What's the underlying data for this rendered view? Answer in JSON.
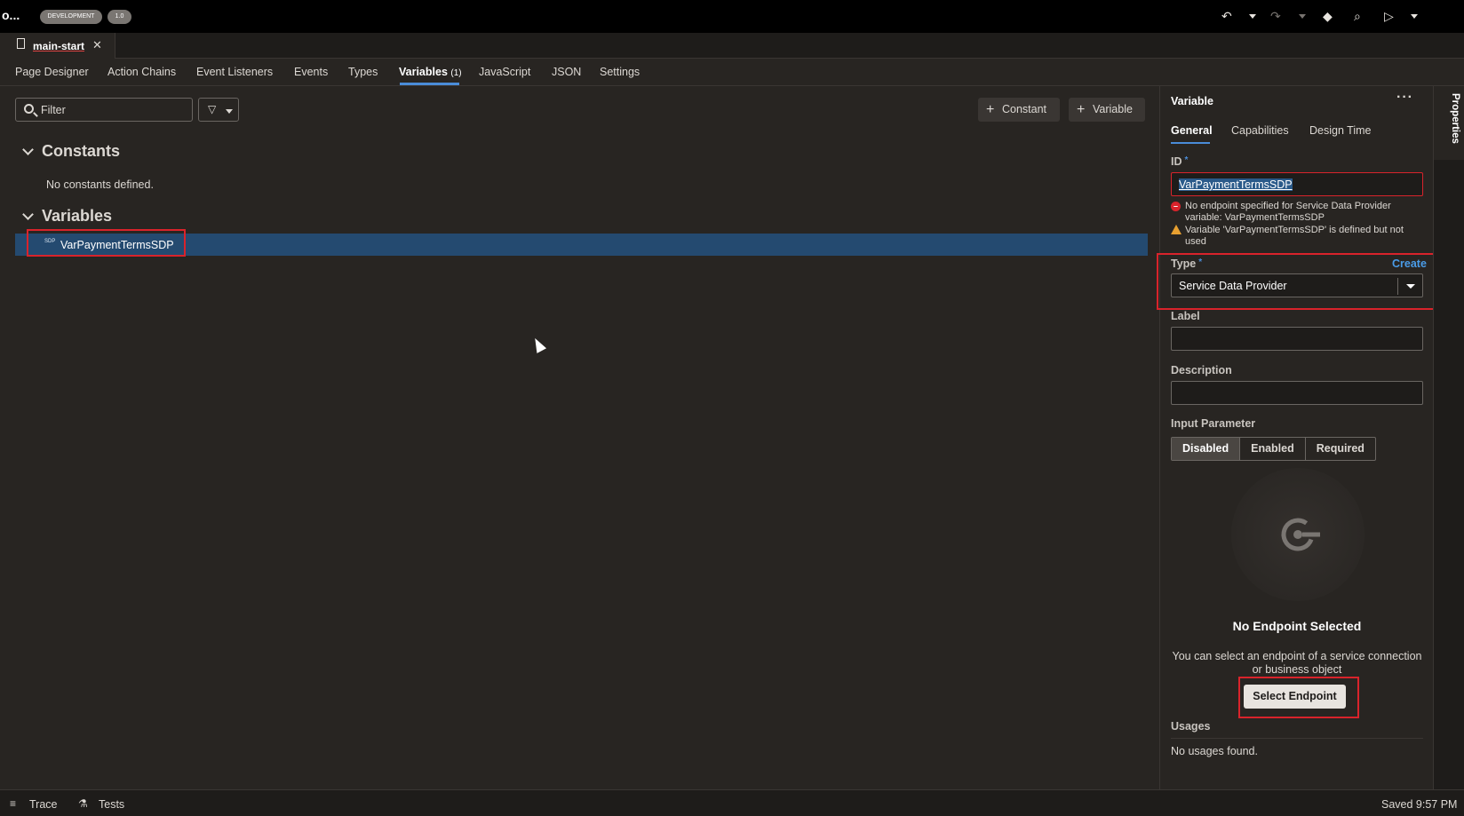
{
  "topbar": {
    "app_name": "o...",
    "env_badge": "DEVELOPMENT",
    "version_badge": "1.0",
    "icons": [
      "undo-icon",
      "caret-down-icon",
      "redo-icon",
      "caret-down-icon",
      "git-icon",
      "search-icon",
      "run-icon",
      "caret-down-icon"
    ]
  },
  "file_tab": {
    "label": "main-start",
    "close": "✕"
  },
  "nav_tabs": [
    {
      "label": "Page Designer"
    },
    {
      "label": "Action Chains"
    },
    {
      "label": "Event Listeners"
    },
    {
      "label": "Events"
    },
    {
      "label": "Types"
    },
    {
      "label": "Variables",
      "count": "(1)"
    },
    {
      "label": "JavaScript"
    },
    {
      "label": "JSON"
    },
    {
      "label": "Settings"
    }
  ],
  "toolbar": {
    "filter_placeholder": "Filter",
    "add_constant": "Constant",
    "add_variable": "Variable"
  },
  "sections": {
    "constants": {
      "title": "Constants",
      "empty": "No constants defined."
    },
    "variables": {
      "title": "Variables",
      "items": [
        {
          "badge": "SDP",
          "label": "VarPaymentTermsSDP"
        }
      ]
    }
  },
  "properties": {
    "title": "Variable",
    "more": "···",
    "tabs": [
      "General",
      "Capabilities",
      "Design Time"
    ],
    "id_label": "ID",
    "id_value": "VarPaymentTermsSDP",
    "error_msg": "No endpoint specified for Service Data Provider variable: VarPaymentTermsSDP",
    "warning_msg": "Variable 'VarPaymentTermsSDP' is defined but not used",
    "type_label": "Type",
    "create_link": "Create",
    "type_value": "Service Data Provider",
    "label_label": "Label",
    "description_label": "Description",
    "input_param_label": "Input Parameter",
    "input_param_options": [
      "Disabled",
      "Enabled",
      "Required"
    ],
    "input_param_selected": "Disabled",
    "endpoint_title": "No Endpoint Selected",
    "endpoint_desc": "You can select an endpoint of a service connection or business object",
    "select_endpoint": "Select Endpoint",
    "usages_label": "Usages",
    "usages_empty": "No usages found."
  },
  "side_strip": {
    "label": "Properties"
  },
  "statusbar": {
    "trace": "Trace",
    "tests": "Tests",
    "saved": "Saved 9:57 PM"
  },
  "colors": {
    "accent": "#4a8cd8",
    "selection": "#244a70",
    "highlight": "#d9232b",
    "warning": "#e8a030"
  }
}
